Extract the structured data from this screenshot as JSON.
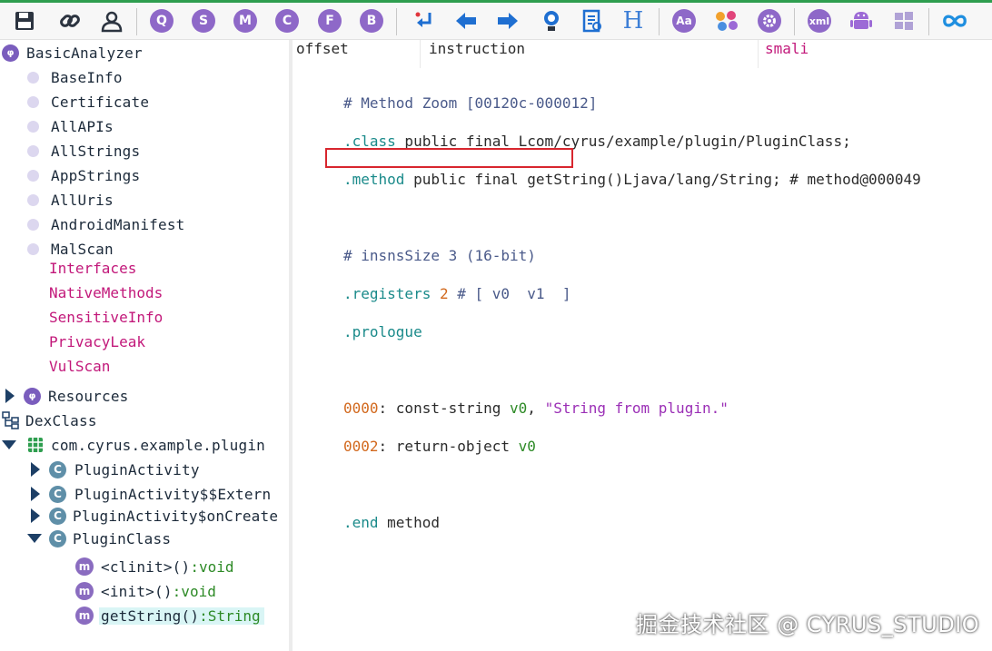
{
  "toolbar": {
    "buttons": [
      {
        "name": "save-icon"
      },
      {
        "name": "link-icon"
      },
      {
        "name": "user-icon"
      },
      {
        "name": "q-icon",
        "letter": "Q"
      },
      {
        "name": "s-icon",
        "letter": "S"
      },
      {
        "name": "m-icon",
        "letter": "M"
      },
      {
        "name": "c-icon",
        "letter": "C"
      },
      {
        "name": "f-icon",
        "letter": "F"
      },
      {
        "name": "b-icon",
        "letter": "B"
      },
      {
        "name": "jump-icon"
      },
      {
        "name": "back-icon"
      },
      {
        "name": "forward-icon"
      },
      {
        "name": "bulb-icon"
      },
      {
        "name": "report-icon"
      },
      {
        "name": "h-icon",
        "letter": "H"
      },
      {
        "name": "font-icon",
        "letter": "Aa"
      },
      {
        "name": "palette-icon"
      },
      {
        "name": "settings-icon"
      },
      {
        "name": "xml-icon",
        "letter": "xml"
      },
      {
        "name": "android-icon"
      },
      {
        "name": "windows-icon"
      },
      {
        "name": "infinity-icon"
      }
    ]
  },
  "tree": {
    "root": "BasicAnalyzer",
    "analyzer_items": [
      "BaseInfo",
      "Certificate",
      "AllAPIs",
      "AllStrings",
      "AppStrings",
      "AllUris",
      "AndroidManifest",
      "MalScan"
    ],
    "analyzer_pink_items": [
      "Interfaces",
      "NativeMethods",
      "SensitiveInfo",
      "PrivacyLeak",
      "VulScan"
    ],
    "resources": "Resources",
    "dexclass": "DexClass",
    "package": "com.cyrus.example.plugin",
    "classes": [
      "PluginActivity",
      "PluginActivity$$Extern",
      "PluginActivity$onCreate",
      "PluginClass"
    ],
    "methods": [
      {
        "name": "<clinit>()",
        "ret": ":void"
      },
      {
        "name": "<init>()",
        "ret": ":void"
      },
      {
        "name": "getString()",
        "ret": ":String"
      }
    ]
  },
  "columns": {
    "offset": "offset",
    "instruction": "instruction",
    "smali": "smali"
  },
  "code": {
    "line1": "# Method Zoom [00120c-000012]",
    "line2_kw": ".class",
    "line2_rest": " public final Lcom/cyrus/example/plugin/PluginClass;",
    "line3_kw": ".method",
    "line3_rest": " public final getString()Ljava/lang/String; # method@000049",
    "line4_a": "# insnsSize ",
    "line4_num": "3",
    "line4_b": " (16-bit)",
    "line5_kw": ".registers",
    "line5_num": " 2",
    "line5_rest": " # [ v0  v1  ]",
    "line6_kw": ".prologue",
    "line7_off": "0000",
    "line7_a": ": const-string ",
    "line7_reg": "v0",
    "line7_b": ", ",
    "line7_str": "\"String from plugin.\"",
    "line8_off": "0002",
    "line8_a": ": return-object ",
    "line8_reg": "v0",
    "line9_kw": ".end",
    "line9_rest": " method"
  },
  "watermark": "掘金技术社区 @ CYRUS_STUDIO",
  "colors": {
    "accent_green": "#2e9e4f",
    "highlight_red": "#d8262e",
    "selection": "#d9f5f5"
  }
}
